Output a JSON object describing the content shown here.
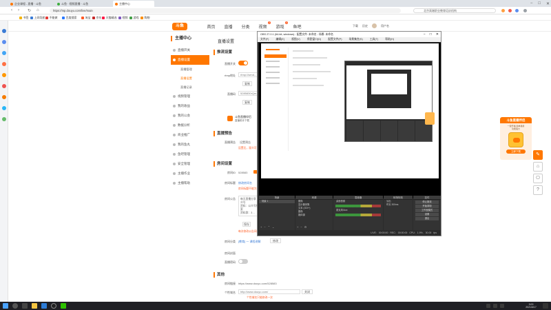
{
  "browser": {
    "tabs": [
      {
        "label": "企业课程...直播 · 斗鱼",
        "color": "#ff7700"
      },
      {
        "label": "斗鱼 · 视频直播 · 斗鱼",
        "color": "#3fae3f"
      },
      {
        "label": "主播中心",
        "color": "#ff7700",
        "active": true
      }
    ],
    "url": "https://mp.douyu.com/live/main",
    "search_text": "北京高端职业教育培训机构",
    "bookmarks": [
      "书签",
      "上网导航",
      "不能做",
      "百度搜索",
      "淘宝",
      "京东",
      "天猫精选",
      "视频",
      "游戏",
      "购物",
      "收藏"
    ]
  },
  "site": {
    "logo": "斗鱼",
    "nav": [
      "首页",
      "直播",
      "分类",
      "视频",
      "游戏",
      "鱼吧"
    ],
    "nav_badges": {
      "3": "1",
      "4": "1"
    },
    "header_right": [
      "下载",
      "历史",
      "用户名"
    ]
  },
  "sidebar": {
    "title": "主播中心",
    "items": [
      {
        "label": "直播开关",
        "active": false
      },
      {
        "label": "直播设置",
        "active": true
      }
    ],
    "subitems": [
      {
        "label": "直播管理",
        "on": false
      },
      {
        "label": "直播设置",
        "on": true
      },
      {
        "label": "直播记录",
        "on": false
      }
    ],
    "items_more": [
      "视频管理",
      "我的收益",
      "我的公会",
      "数据分析",
      "商业推广",
      "我的鱼丸",
      "鱼吧管理",
      "安全管理",
      "主播作业",
      "主播帮助"
    ]
  },
  "content": {
    "page_title": "直播设置",
    "stream": {
      "section": "推流设置",
      "switch_label": "直播开关",
      "rtmp_label": "rtmp地址",
      "rtmp_value": "rtmp://send...",
      "copy1": "复制",
      "code_label": "直播码",
      "code_value": "5285830rQm...",
      "copy2": "复制",
      "promo_title": "斗鱼直播伴侣",
      "promo_sub": "直播助手下载"
    },
    "notice": {
      "section": "直播预告",
      "label": "直播预告",
      "value": "设置预告",
      "warn": "设置后，观众可在房间"
    },
    "room": {
      "section": "房间设置",
      "room_id_label": "房间ID",
      "room_id": "528583",
      "name_label": "房间标题",
      "name_link": "修改房间名",
      "name_warn": "房间标题不能为空",
      "notice_label": "房间公告",
      "notice_text": "每天直播分享 - 公众号\n资料：公众号搜索\n资料群：3…",
      "save": "保存",
      "notice_warn": "每次修改公告间隔一天",
      "cat_label": "房间分类",
      "cat_link": "[教育] 一 课程讲解",
      "cat_btn": "修改",
      "cover_label": "房间封面",
      "pw_label": "直播密码"
    },
    "other": {
      "section": "其他",
      "link_label": "房间链接",
      "link_value": "https://www.douyu.com/528583",
      "bind_label": "个性域名",
      "bind_value": "http://www.douyu.com/",
      "bind_btn": "关闭",
      "bind_warn": "个性域名只能修改一次"
    }
  },
  "obs": {
    "title": "OBS 27.0.1 (64-bit, windows) - 配置文件: 未命名 - 场景: 未命名",
    "menu": [
      "文件(F)",
      "编辑(E)",
      "视图(V)",
      "停靠窗口(D)",
      "配置文件(P)",
      "场景集合(S)",
      "工具(T)",
      "帮助(H)"
    ],
    "docks": {
      "scenes": {
        "title": "场景",
        "items": [
          "场景 1"
        ]
      },
      "sources": {
        "title": "来源",
        "items": [
          "图像",
          "显示器采集",
          "文本 (GDI+)",
          "图像",
          "媒体源"
        ]
      },
      "mixer": {
        "title": "混音器",
        "items": [
          "桌面音频",
          "麦克风/Aux"
        ]
      },
      "transitions": {
        "title": "转场特效",
        "items": [
          "淡出",
          "时长 300ms"
        ]
      },
      "controls": {
        "title": "控件",
        "items": [
          "停止推流",
          "开始录制",
          "工作室模式",
          "设置",
          "退出"
        ]
      }
    },
    "status": "LIVE: 00:00:00   REC: 00:00:00   CPU: 1.9%, 30.00 fps"
  },
  "ad": {
    "head": "斗鱼直播伴侣",
    "sub": "一键开播 简单易用\n功能强大",
    "button": "立即下载"
  },
  "taskbar": {
    "time": "3:00",
    "date": "2021/6/17"
  }
}
